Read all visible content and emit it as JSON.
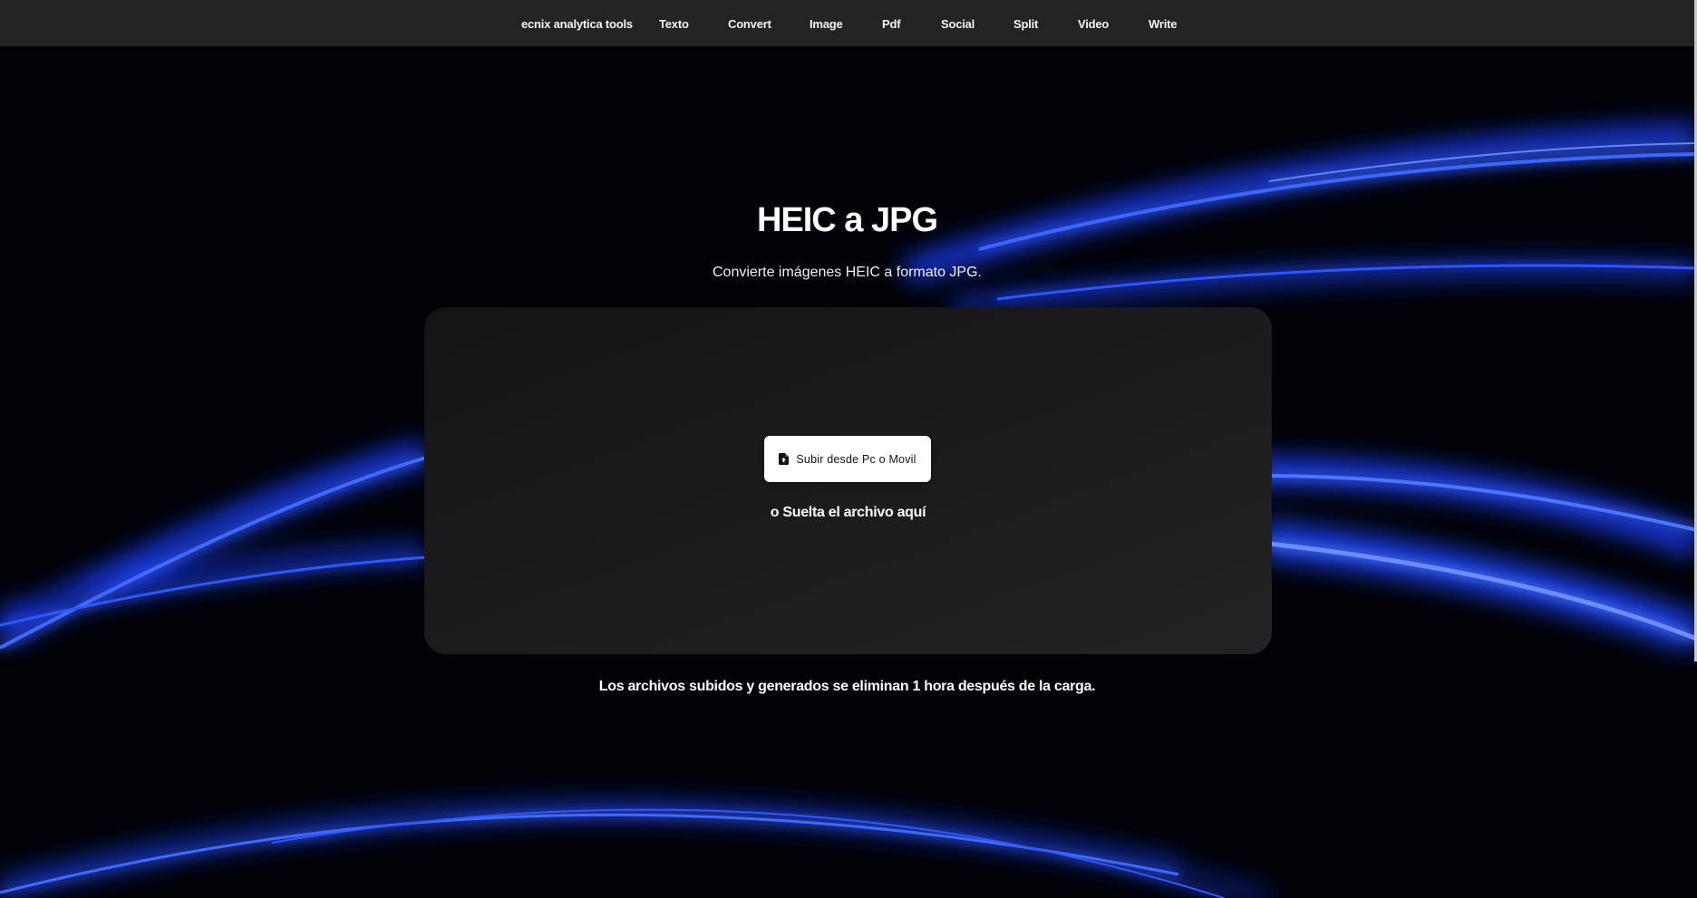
{
  "nav": {
    "brand": "ecnix analytica tools",
    "items": [
      "Texto",
      "Convert",
      "Image",
      "Pdf",
      "Social",
      "Split",
      "Video",
      "Write"
    ]
  },
  "hero": {
    "title": "HEIC a JPG",
    "subtitle": "Convierte imágenes HEIC a formato JPG."
  },
  "dropzone": {
    "upload_label": "Subir desde Pc o Movil",
    "upload_icon": "file-upload-icon",
    "drop_hint": "o Suelta el archivo aquí"
  },
  "footer": {
    "note": "Los archivos subidos y generados se eliminan 1 hora después de la carga."
  },
  "colors": {
    "background": "#000206",
    "nav_background": "#232323",
    "accent_glow": "#1f4dff",
    "panel": "#1c1c1e",
    "button": "#ffffff"
  }
}
